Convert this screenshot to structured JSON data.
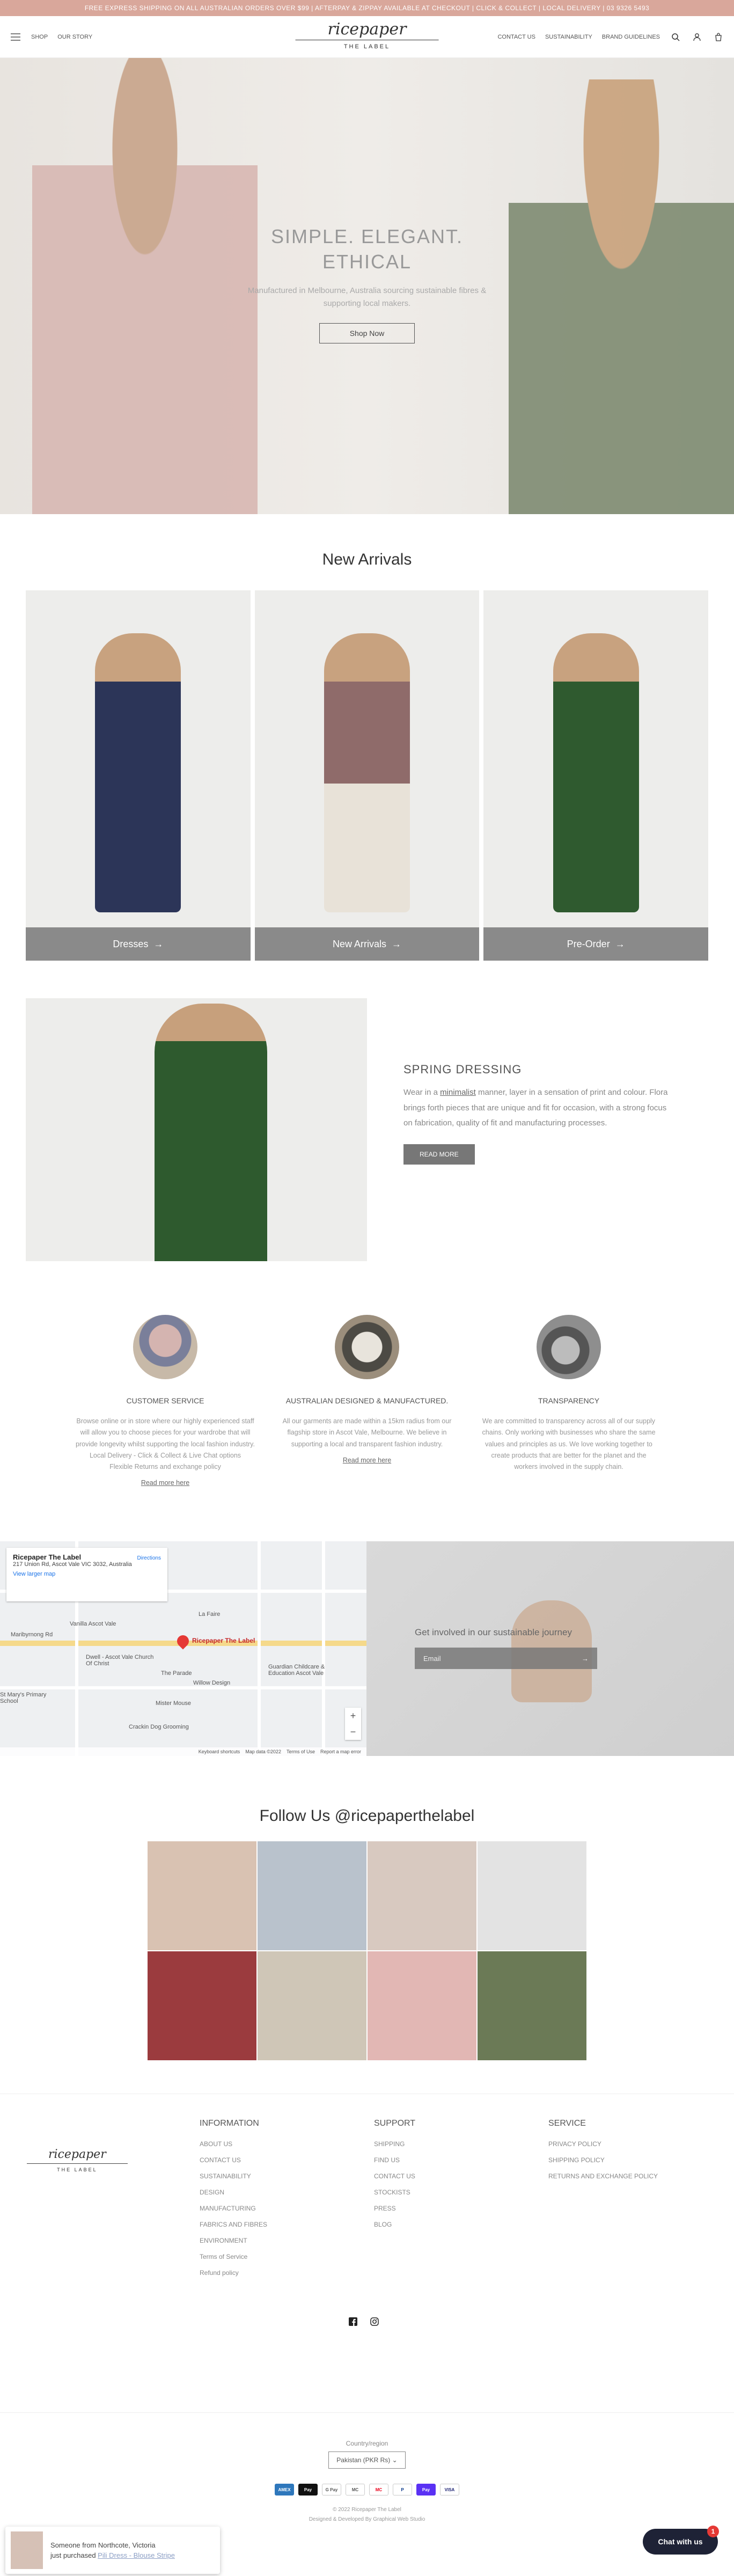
{
  "announcement": "FREE EXPRESS SHIPPING ON ALL AUSTRALIAN ORDERS OVER $99 | AFTERPAY & ZIPPAY AVAILABLE AT CHECKOUT | CLICK & COLLECT | LOCAL DELIVERY | 03 9326 5493",
  "header": {
    "nav": [
      "Shop",
      "Our Story"
    ],
    "right_links": [
      "Contact Us",
      "Sustainability",
      "Brand Guidelines"
    ],
    "logo_script": "ricepaper",
    "logo_sub": "THE LABEL"
  },
  "hero": {
    "title": "SIMPLE. ELEGANT. ETHICAL",
    "subtitle": "Manufactured in Melbourne, Australia sourcing sustainable fibres & supporting local makers.",
    "button": "Shop Now"
  },
  "arrivals": {
    "title": "New Arrivals",
    "cards": [
      {
        "label": "Dresses",
        "color": "#2c3558"
      },
      {
        "label": "New Arrivals",
        "color": "#8f6b6a"
      },
      {
        "label": "Pre-Order",
        "color": "#2f5a2f"
      }
    ]
  },
  "spring": {
    "title": "SPRING DRESSING",
    "body_pre": "Wear in a ",
    "body_link": "minimalist",
    "body_post": " manner, layer in a sensation of print and colour. Flora brings forth pieces that are unique and fit for occasion, with a strong focus on fabrication, quality of fit and manufacturing processes.",
    "button": "READ MORE"
  },
  "features": [
    {
      "title": "CUSTOMER SERVICE",
      "body": "Browse online or in store where our highly experienced staff will allow you to choose pieces for your wardrobe that will provide longevity whilst supporting the local fashion industry.",
      "extra1": "Local Delivery - Click & Collect & Live Chat options",
      "extra2": "Flexible Returns and exchange policy",
      "link": "Read more here"
    },
    {
      "title": "AUSTRALIAN DESIGNED & MANUFACTURED.",
      "body": "All our garments are made within a 15km radius from our flagship store in Ascot Vale, Melbourne. We believe in supporting a local and transparent fashion industry.",
      "link": "Read more here"
    },
    {
      "title": "TRANSPARENCY",
      "body": "We are committed to transparency across all of our supply chains. Only working with businesses who share the same values and principles as us. We love working together to create products that are better for the planet and the workers involved in the supply chain."
    }
  ],
  "map": {
    "place": "Ricepaper The Label",
    "address": "217 Union Rd, Ascot Vale VIC 3032, Australia",
    "directions": "Directions",
    "larger_map": "View larger map",
    "pin_label": "Ricepaper The Label",
    "labels": [
      "Vanilla Ascot Vale",
      "Dwell - Ascot Vale Church Of Christ",
      "St Mary's Primary School",
      "Willow Design",
      "Mister Mouse",
      "Guardian Childcare & Education Ascot Vale",
      "La Faire",
      "Crackin Dog Grooming",
      "Maribyrnong Rd",
      "The Parade",
      "Keyboard shortcuts",
      "Map data ©2022",
      "Terms of Use",
      "Report a map error"
    ]
  },
  "newsletter": {
    "title": "Get involved in our sustainable journey",
    "placeholder": "Email"
  },
  "follow": {
    "title": "Follow Us @ricepaperthelabel",
    "tiles": [
      "#d9c2b2",
      "#b9c2cc",
      "#d8c9c0",
      "#e3e3e3",
      "#9b3b3e",
      "#cfc6b7",
      "#e2b7b4",
      "#6b7a56"
    ]
  },
  "footer": {
    "columns": [
      {
        "title": "INFORMATION",
        "items": [
          "ABOUT US",
          "CONTACT US",
          "SUSTAINABILITY",
          "DESIGN",
          "MANUFACTURING",
          "FABRICS AND FIBRES",
          "ENVIRONMENT",
          "Terms of Service",
          "Refund policy"
        ]
      },
      {
        "title": "SUPPORT",
        "items": [
          "SHIPPING",
          "FIND US",
          "CONTACT US",
          "STOCKISTS",
          "PRESS",
          "BLOG"
        ]
      },
      {
        "title": "SERVICE",
        "items": [
          "PRIVACY POLICY",
          "SHIPPING POLICY",
          "RETURNS AND EXCHANGE POLICY"
        ]
      }
    ],
    "country_label": "Country/region",
    "country_value": "Pakistan (PKR Rs) ⌄",
    "payments": [
      "AMEX",
      "Pay",
      "G Pay",
      "MC",
      "MC",
      "P",
      "Pay",
      "VISA"
    ],
    "copyright": "© 2022 Ricepaper The Label",
    "designed": "Designed & Developed By Graphical Web Studio"
  },
  "toast": {
    "line1": "Someone from Northcote, Victoria",
    "line2_pre": "just purchased ",
    "line2_prod": "Pili Dress - Blouse Stripe"
  },
  "chat": {
    "label": "Chat with us",
    "badge": "1"
  }
}
